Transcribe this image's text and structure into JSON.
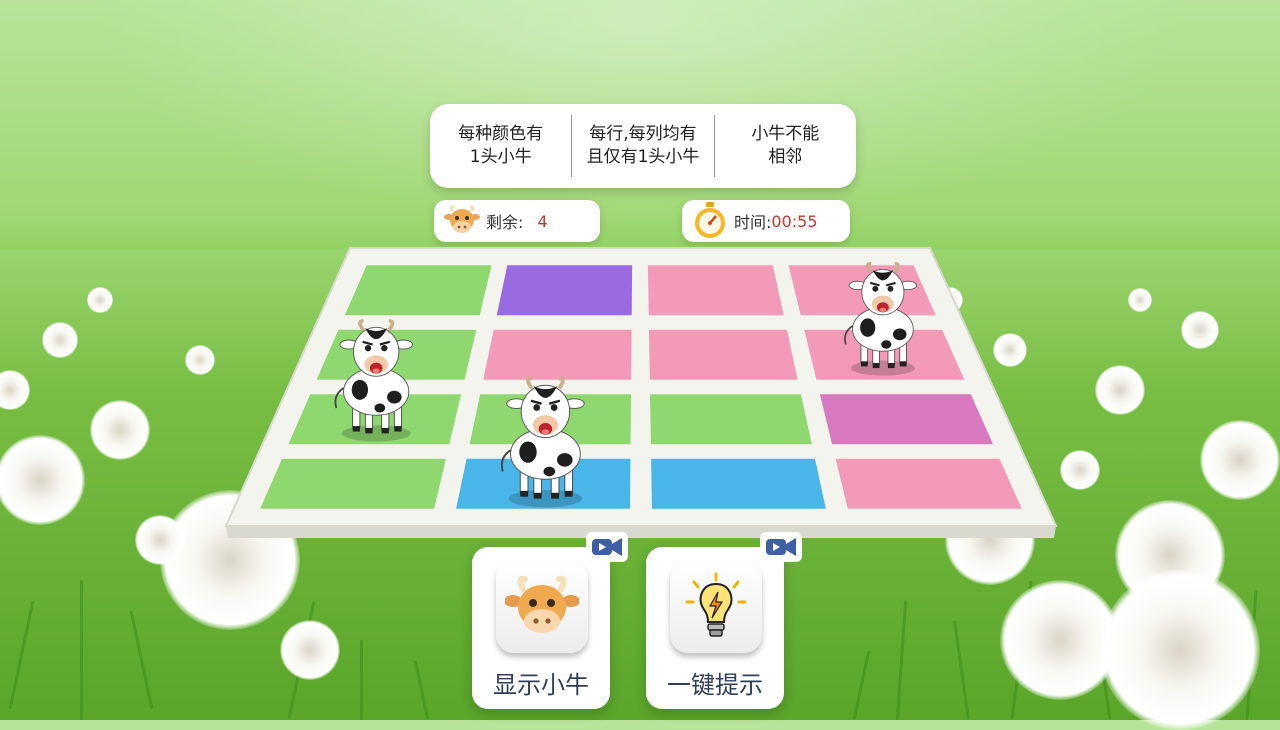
{
  "rules": [
    {
      "text": "每种颜色有\n1头小牛"
    },
    {
      "text": "每行,每列均有\n且仅有1头小牛"
    },
    {
      "text": "小牛不能\n相邻"
    }
  ],
  "status": {
    "remaining_label": "剩余:",
    "remaining_value": "4",
    "timer_label": "时间:",
    "timer_value": "00:55"
  },
  "board": {
    "rows": 4,
    "cols": 4,
    "colors": {
      "green": "#8fd870",
      "purple": "#9a6be0",
      "pink": "#f29ab7",
      "blue": "#49b6ea",
      "magenta": "#d878bf"
    },
    "cells": [
      [
        "green",
        "purple",
        "pink",
        "pink"
      ],
      [
        "green",
        "pink",
        "pink",
        "pink"
      ],
      [
        "green",
        "green",
        "green",
        "magenta"
      ],
      [
        "green",
        "blue",
        "blue",
        "pink"
      ]
    ],
    "cows": [
      {
        "row": 2,
        "col": 0
      },
      {
        "row": 3,
        "col": 1
      },
      {
        "row": 1,
        "col": 3
      }
    ]
  },
  "buttons": {
    "show_cow_label": "显示小牛",
    "hint_label": "一键提示",
    "video_icon": "video-camera-icon"
  }
}
